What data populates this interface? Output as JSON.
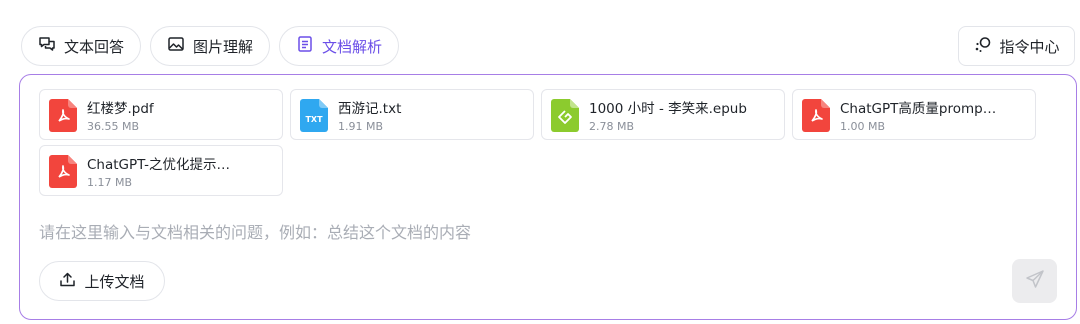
{
  "tabs": [
    {
      "label": "文本回答",
      "icon": "chat-bubbles-icon",
      "active": false
    },
    {
      "label": "图片理解",
      "icon": "image-icon",
      "active": false
    },
    {
      "label": "文档解析",
      "icon": "document-icon",
      "active": true
    }
  ],
  "command_center": {
    "label": "指令中心",
    "icon": "command-center-icon"
  },
  "files": [
    {
      "name": "红楼梦.pdf",
      "size": "36.55 MB",
      "type": "pdf"
    },
    {
      "name": "西游记.txt",
      "size": "1.91 MB",
      "type": "txt",
      "badge": "TXT"
    },
    {
      "name": "1000 小时 - 李笑来.epub",
      "size": "2.78 MB",
      "type": "epub"
    },
    {
      "name": "ChatGPT高质量promp…",
      "size": "1.00 MB",
      "type": "pdf"
    },
    {
      "name": "ChatGPT-之优化提示…",
      "size": "1.17 MB",
      "type": "pdf"
    }
  ],
  "input": {
    "placeholder": "请在这里输入与文档相关的问题，例如：总结这个文档的内容"
  },
  "upload": {
    "label": "上传文档",
    "icon": "upload-icon"
  },
  "send": {
    "icon": "send-icon"
  },
  "colors": {
    "accent": "#6b4fe8",
    "panel_border": "#a77ee6",
    "pdf": "#f2453d",
    "txt": "#2fa8f0",
    "epub": "#8ccb2e"
  }
}
